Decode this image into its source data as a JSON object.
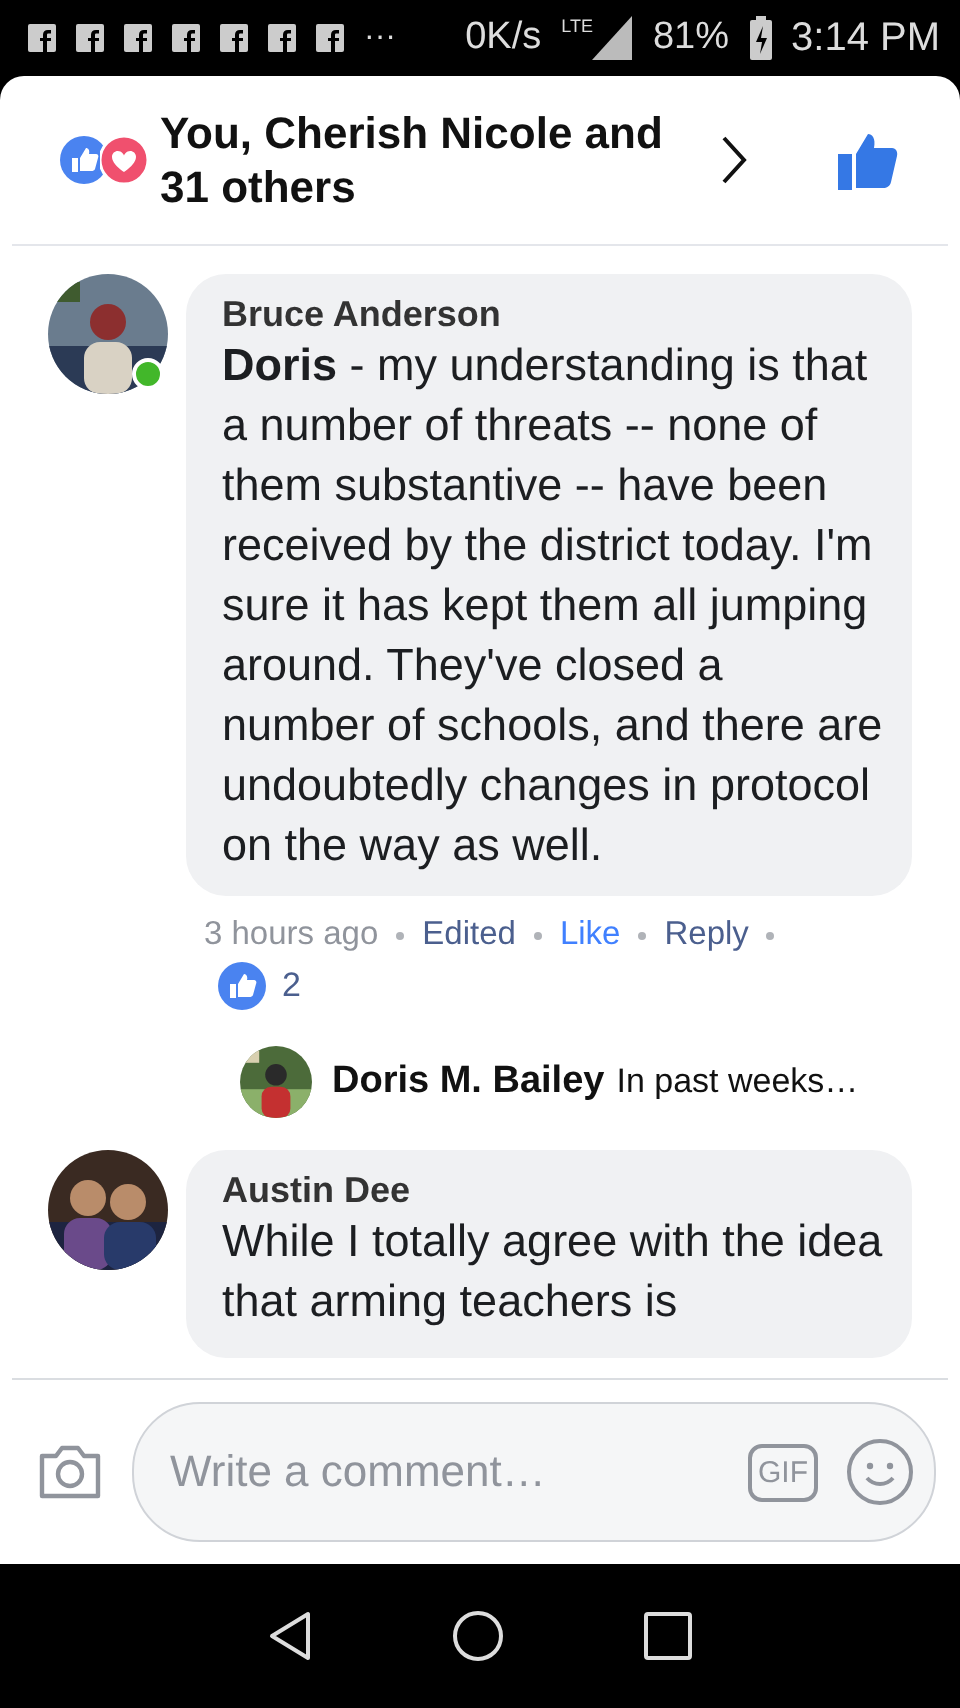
{
  "status_bar": {
    "overflow": "···",
    "speed": "0K/s",
    "network": "LTE",
    "battery": "81%",
    "time": "3:14 PM",
    "notifications": [
      {
        "kind": "facebook"
      },
      {
        "kind": "facebook"
      },
      {
        "kind": "facebook"
      },
      {
        "kind": "facebook"
      },
      {
        "kind": "facebook"
      },
      {
        "kind": "facebook"
      },
      {
        "kind": "facebook"
      }
    ]
  },
  "header": {
    "reactions_text": "You, Cherish Nicole and 31 others",
    "liked": true
  },
  "comments": [
    {
      "author": "Bruce Anderson",
      "online": true,
      "text": "**Doris** - my understanding is that a number of threats -- none of them substantive -- have been received by the district today.  I'm sure it has kept them all jumping around. They've closed a number of schools, and there are undoubtedly changes in protocol on the way as well.",
      "time": "3 hours ago",
      "edited": "Edited",
      "like": "Like",
      "liked": true,
      "reply": "Reply",
      "reaction_count": "2",
      "reply_preview": {
        "author": "Doris M. Bailey",
        "text": "In past weeks…"
      }
    },
    {
      "author": "Austin Dee",
      "online": false,
      "text": "While I totally agree with the idea that arming teachers is"
    }
  ],
  "composer": {
    "placeholder": "Write a comment…",
    "gif": "GIF"
  }
}
